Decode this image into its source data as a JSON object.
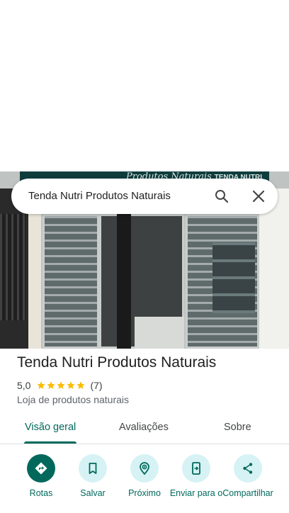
{
  "search": {
    "query": "Tenda Nutri Produtos Naturais"
  },
  "photo": {
    "sign_text": "Produtos Naturais",
    "sign_text_2": "TENDA NUTRI"
  },
  "place": {
    "title": "Tenda Nutri Produtos Naturais",
    "rating": "5,0",
    "stars": 5,
    "review_count": "(7)",
    "category": "Loja de produtos naturais"
  },
  "tabs": [
    {
      "label": "Visão geral",
      "active": true
    },
    {
      "label": "Avaliações",
      "active": false
    },
    {
      "label": "Sobre",
      "active": false
    }
  ],
  "actions": [
    {
      "label": "Rotas",
      "icon": "directions-icon"
    },
    {
      "label": "Salvar",
      "icon": "bookmark-icon"
    },
    {
      "label": "Próximo",
      "icon": "nearby-icon"
    },
    {
      "label": "Enviar para o",
      "icon": "send-to-phone-icon"
    },
    {
      "label": "Compartilhar",
      "icon": "share-icon"
    }
  ],
  "colors": {
    "accent": "#00695c",
    "action_bg": "#d6f2f4",
    "star": "#fbbc04"
  }
}
